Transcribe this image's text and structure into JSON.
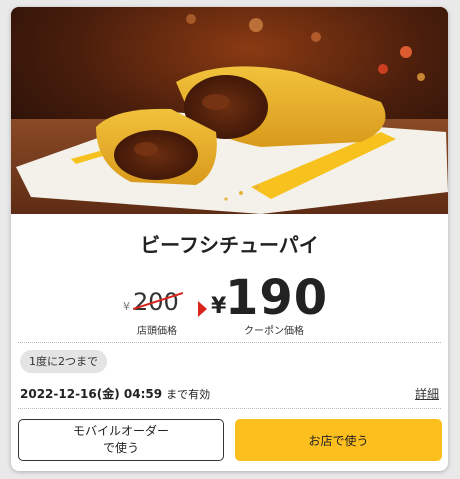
{
  "coupon": {
    "title": "ビーフシチューパイ",
    "currency_symbol": "¥",
    "original_price": "200",
    "original_price_label": "店頭価格",
    "coupon_price": "190",
    "coupon_price_label": "クーポン価格",
    "usage_limit": "1度に2つまで",
    "valid_until": "2022-12-16(金) 04:59",
    "valid_suffix": "まで有効",
    "details_link": "詳細",
    "mobile_order_line1": "モバイルオーダー",
    "mobile_order_line2": "で使う",
    "use_in_store": "お店で使う"
  },
  "colors": {
    "accent_yellow": "#fcbf1e",
    "price_arrow_red": "#d8261c"
  },
  "photo": {
    "icon": "beef-stew-pie-photo"
  }
}
